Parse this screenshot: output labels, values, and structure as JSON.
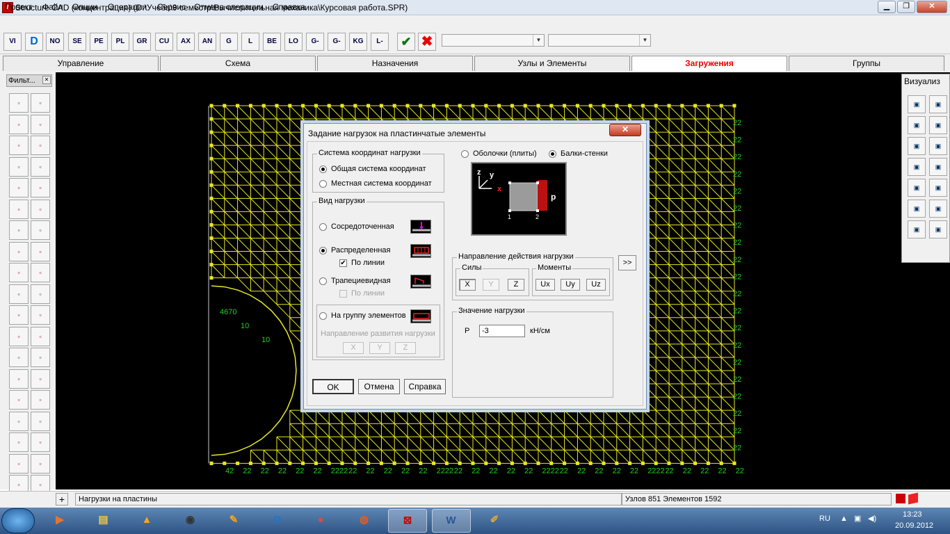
{
  "window": {
    "title": "Structure CAD (концентрация) (D:\\Учеба\\9 семестр\\Вычислительная механика\\Курсовая работа.SPR)",
    "app_icon": "lira-icon",
    "btn_minimize": "minimize-icon",
    "btn_maximize": "maximize-icon",
    "btn_close": "close-icon"
  },
  "menu": [
    "Проект",
    "Файл",
    "Опции",
    "Операции",
    "Сервис",
    "Отмена операции",
    "Справка"
  ],
  "toolbar": {
    "tools": [
      "views-icon",
      "D",
      "nodes-icon",
      "select-icon",
      "pencil-icon",
      "plate-icon",
      "grid-icon",
      "cube-icon",
      "axes-icon",
      "angle-icon",
      "G-icon",
      "L-icon",
      "beam-icon",
      "load-icon",
      "G-L-icon",
      "G-kL-icon",
      "kG-icon",
      "L-table-icon"
    ],
    "ok_icon": "check-icon",
    "cancel_icon": "cross-icon",
    "combo1": "",
    "combo2": ""
  },
  "tabs": [
    "Управление",
    "Схема",
    "Назначения",
    "Узлы и Элементы",
    "Загружения",
    "Группы"
  ],
  "tab_active_index": 4,
  "left_panel": {
    "title": "Фильт...",
    "buttons": [
      "pencil-icon",
      "eraser-icon",
      "cube-icon",
      "spring-icon",
      "bar-i-icon",
      "bar-i2-icon",
      "bar-ne-icon",
      "bar-ng-icon",
      "bar-te-icon",
      "bar-r-icon",
      "truss-icon",
      "truss2-icon",
      "cross-icon",
      "cross2-icon",
      "hatch-icon",
      "hatch2-icon",
      "load-f-icon",
      "load-f2-icon",
      "load-m-icon",
      "load-m2-icon",
      "pivot-icon",
      "pivot2-icon",
      "node-icon",
      "grid-icon",
      "table-icon",
      "table2-icon",
      "pen-icon",
      "brush-icon",
      "layers-icon",
      "axis-icon",
      "bar-n-icon",
      "bar-g-icon",
      "bar-c-icon",
      "bar-l-icon",
      "dot-grid-icon",
      "red-grid-icon",
      "gl-icon",
      "chart-icon",
      "table3-icon",
      "layers2-icon"
    ]
  },
  "right_panel": {
    "title": "Визуализ",
    "buttons": [
      "view-top-icon",
      "rotate-x-icon",
      "rotate-z-icon",
      "rotate-y-icon",
      "box-front-icon",
      "box-side-icon",
      "box-iso-icon",
      "box-iso2-icon",
      "frame-icon",
      "frame2-icon",
      "no-icon",
      "print-icon",
      "select-frame-icon",
      "grid-red-icon"
    ]
  },
  "mesh": {
    "line_color": "#e8e828",
    "label_color": "#22d022",
    "bottom_labels": [
      "42",
      "22",
      "22",
      "22",
      "22",
      "22",
      "2222",
      "22",
      "22",
      "22",
      "22",
      "22",
      "2222",
      "22",
      "22",
      "22",
      "22",
      "22",
      "2222",
      "22",
      "22",
      "22",
      "22",
      "22",
      "2222",
      "22",
      "22",
      "22",
      "22",
      "22"
    ],
    "right_labels": [
      "22",
      "22",
      "22",
      "22",
      "22",
      "22",
      "22",
      "22",
      "22",
      "22",
      "22",
      "22",
      "22",
      "22",
      "22",
      "22",
      "22",
      "22",
      "22",
      "22"
    ],
    "hole_labels": [
      "4670",
      "10",
      "10"
    ]
  },
  "dialog": {
    "title": "Задание нагрузок на пластинчатые элементы",
    "coord_group": "Система координат нагрузки",
    "coord_global": "Общая система координат",
    "coord_local": "Местная  система координат",
    "load_type_group": "Вид нагрузки",
    "concentrated": "Сосредоточенная",
    "distributed": "Распределенная",
    "along_line": "По линии",
    "trapezoid": "Трапециевидная",
    "trap_line": "По линии",
    "group": "На группу элементов",
    "dev_dir": "Направление развития нагрузки",
    "dev_x": "X",
    "dev_y": "Y",
    "dev_z": "Z",
    "shells": "Оболочки (плиты)",
    "walls": "Балки-стенки",
    "preview": {
      "axis_z": "z",
      "axis_y": "y",
      "axis_x": "x",
      "node1": "1",
      "node2": "2",
      "p": "p"
    },
    "direction_group": "Направление действия нагрузки",
    "forces_group": "Силы",
    "fx": "X",
    "fy": "Y",
    "fz": "Z",
    "moments_group": "Моменты",
    "ux": "Ux",
    "uy": "Uy",
    "uz": "Uz",
    "more": ">>",
    "value_group": "Значение нагрузки",
    "p_label": "P",
    "p_value": "-3",
    "unit": "кН/см",
    "ok": "OK",
    "cancel": "Отмена",
    "help": "Справка"
  },
  "status": {
    "left": "Нагрузки на пластины",
    "right": "Узлов 851 Элементов 1592"
  },
  "taskbar": {
    "apps": [
      "media-player-icon",
      "folder-icon",
      "vlc-icon",
      "media-center-icon",
      "chat-icon",
      "teamviewer-icon",
      "chrome-icon",
      "firefox-icon",
      "lira-icon",
      "word-icon",
      "paint-icon"
    ],
    "lang": "RU",
    "time": "13:23",
    "date": "20.09.2012"
  }
}
